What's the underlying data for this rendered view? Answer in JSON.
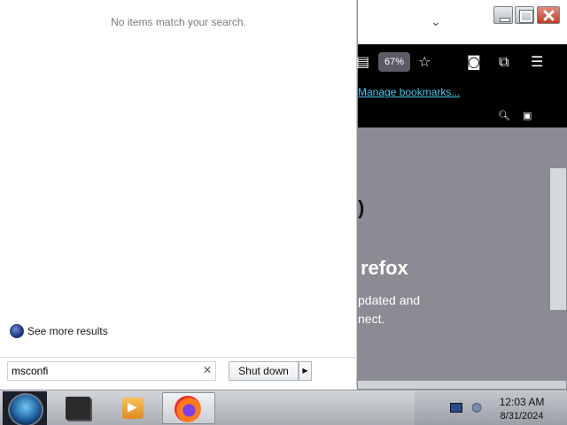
{
  "start_menu": {
    "no_results_text": "No items match your search.",
    "see_more_label": "See more results",
    "search": {
      "value": "msconfi",
      "clear_icon": "close-icon"
    },
    "shutdown_label": "Shut down",
    "shutdown_arrow": "▶"
  },
  "firefox": {
    "zoom_level": "67%",
    "manage_bookmarks_label": "Manage bookmarks...",
    "page": {
      "partial_glyph": ")",
      "heading_partial": "refox",
      "line1_partial": "pdated and",
      "line2_partial": "nect."
    },
    "colors": {
      "toolbar_bg": "#000000",
      "content_bg": "#8b8b93",
      "link": "#45c7f0"
    }
  },
  "taskbar": {
    "apps": [
      {
        "name": "command-prompt",
        "icon": "terminal-icon"
      },
      {
        "name": "media-center",
        "icon": "media-icon"
      },
      {
        "name": "firefox",
        "icon": "firefox-icon",
        "active": true
      }
    ],
    "clock": {
      "time": "12:03 AM",
      "date": "8/31/2024"
    }
  }
}
